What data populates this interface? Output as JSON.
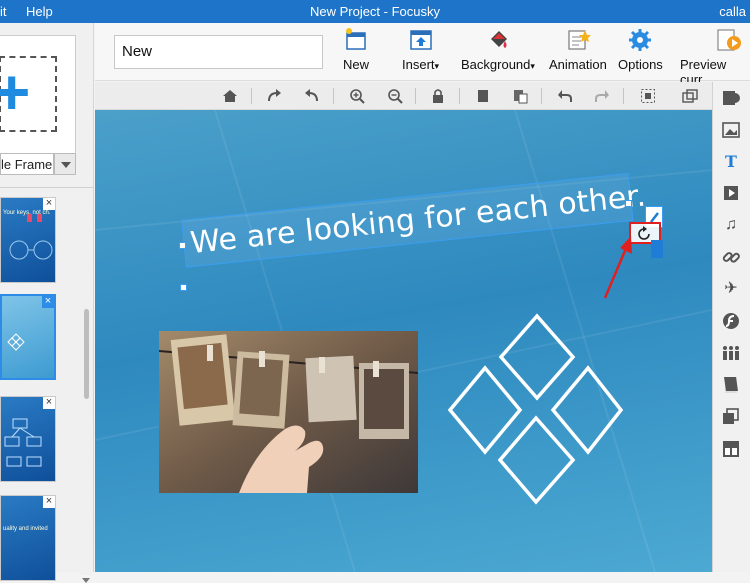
{
  "titlebar": {
    "menu_edit_partial": "it",
    "menu_help": "Help",
    "title": "New Project - Focusky",
    "user_partial": "calla"
  },
  "leftpanel": {
    "frame_type": "le Frame",
    "thumbs": [
      {
        "text": "Your keys, not ch."
      },
      {
        "text": ""
      },
      {
        "text": ""
      },
      {
        "text": "uality and invited"
      }
    ]
  },
  "toolbar": {
    "search_value": "New",
    "new_label": "New",
    "insert_label": "Insert",
    "background_label": "Background",
    "animation_label": "Animation",
    "options_label": "Options",
    "preview_label": "Preview curr"
  },
  "canvas": {
    "text": "We are looking for each other."
  },
  "colors": {
    "titlebar": "#1d74c9",
    "accent": "#2d8ce8",
    "highlight": "#e02020"
  }
}
